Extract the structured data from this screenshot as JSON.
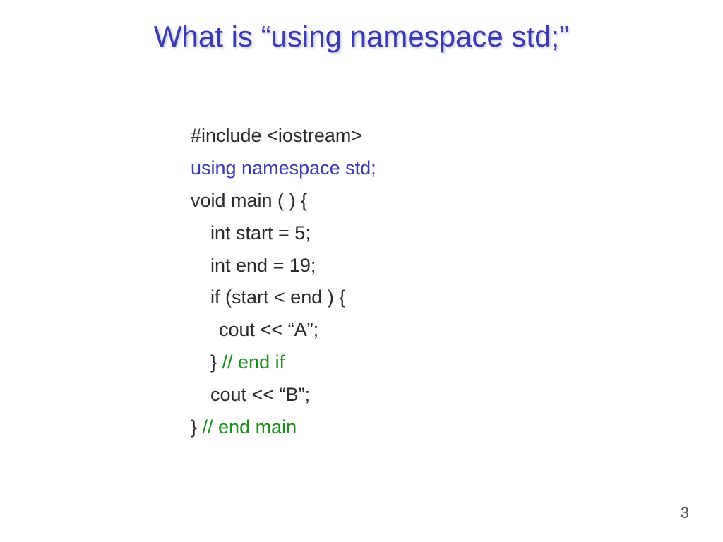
{
  "title": "What is “using namespace std;”",
  "code": {
    "line1": "#include <iostream>",
    "line2": "using namespace std;",
    "line3": "void main ( ) {",
    "line4": "int start = 5;",
    "line5": "int end = 19;",
    "line6": "if (start < end ) {",
    "line7": "cout << “A”;",
    "line8_close": "} ",
    "line8_comment": "// end if",
    "line9": "cout << “B”;",
    "line10_close": "} ",
    "line10_comment": "// end main"
  },
  "page_number": "3"
}
